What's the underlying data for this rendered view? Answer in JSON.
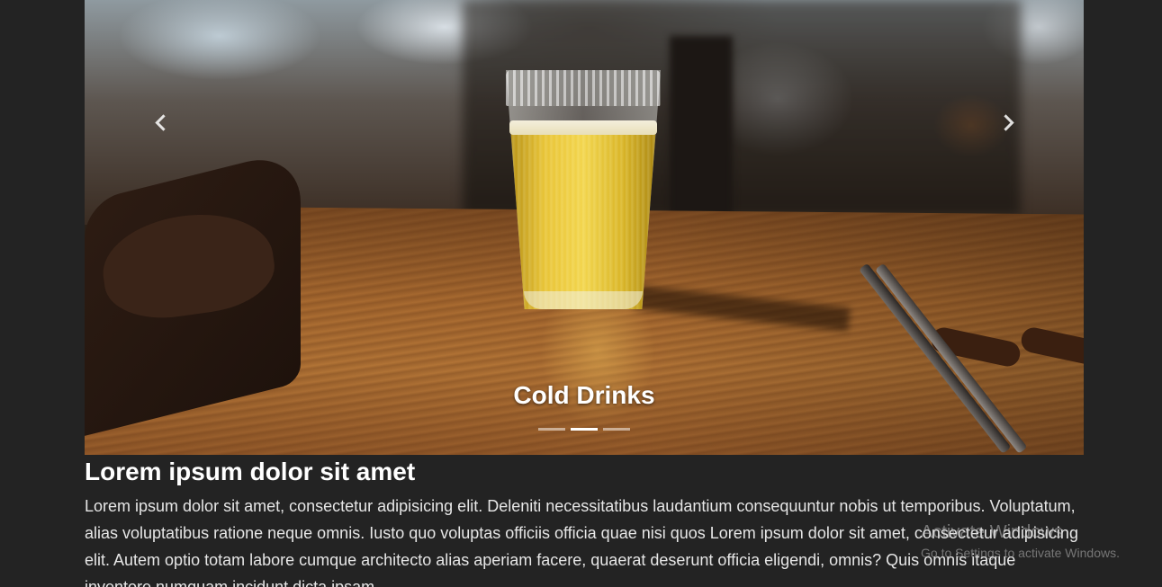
{
  "carousel": {
    "caption": "Cold Drinks",
    "prev_icon": "chevron-left-icon",
    "next_icon": "chevron-right-icon",
    "indicators": [
      {
        "active": false
      },
      {
        "active": true
      },
      {
        "active": false
      }
    ]
  },
  "content": {
    "heading": "Lorem ipsum dolor sit amet",
    "paragraph": "Lorem ipsum dolor sit amet, consectetur adipisicing elit. Deleniti necessitatibus laudantium consequuntur nobis ut temporibus. Voluptatum, alias voluptatibus ratione neque omnis. Iusto quo voluptas officiis officia quae nisi quos Lorem ipsum dolor sit amet, consectetur adipisicing elit. Autem optio totam labore cumque architecto alias aperiam facere, quaerat deserunt officia eligendi, omnis? Quis omnis itaque inventore numquam incidunt dicta ipsam."
  },
  "watermark": {
    "title": "Activate Windows",
    "subtitle": "Go to Settings to activate Windows."
  },
  "colors": {
    "page_background": "#232323",
    "text": "#e6e6e6",
    "heading": "#ffffff"
  }
}
